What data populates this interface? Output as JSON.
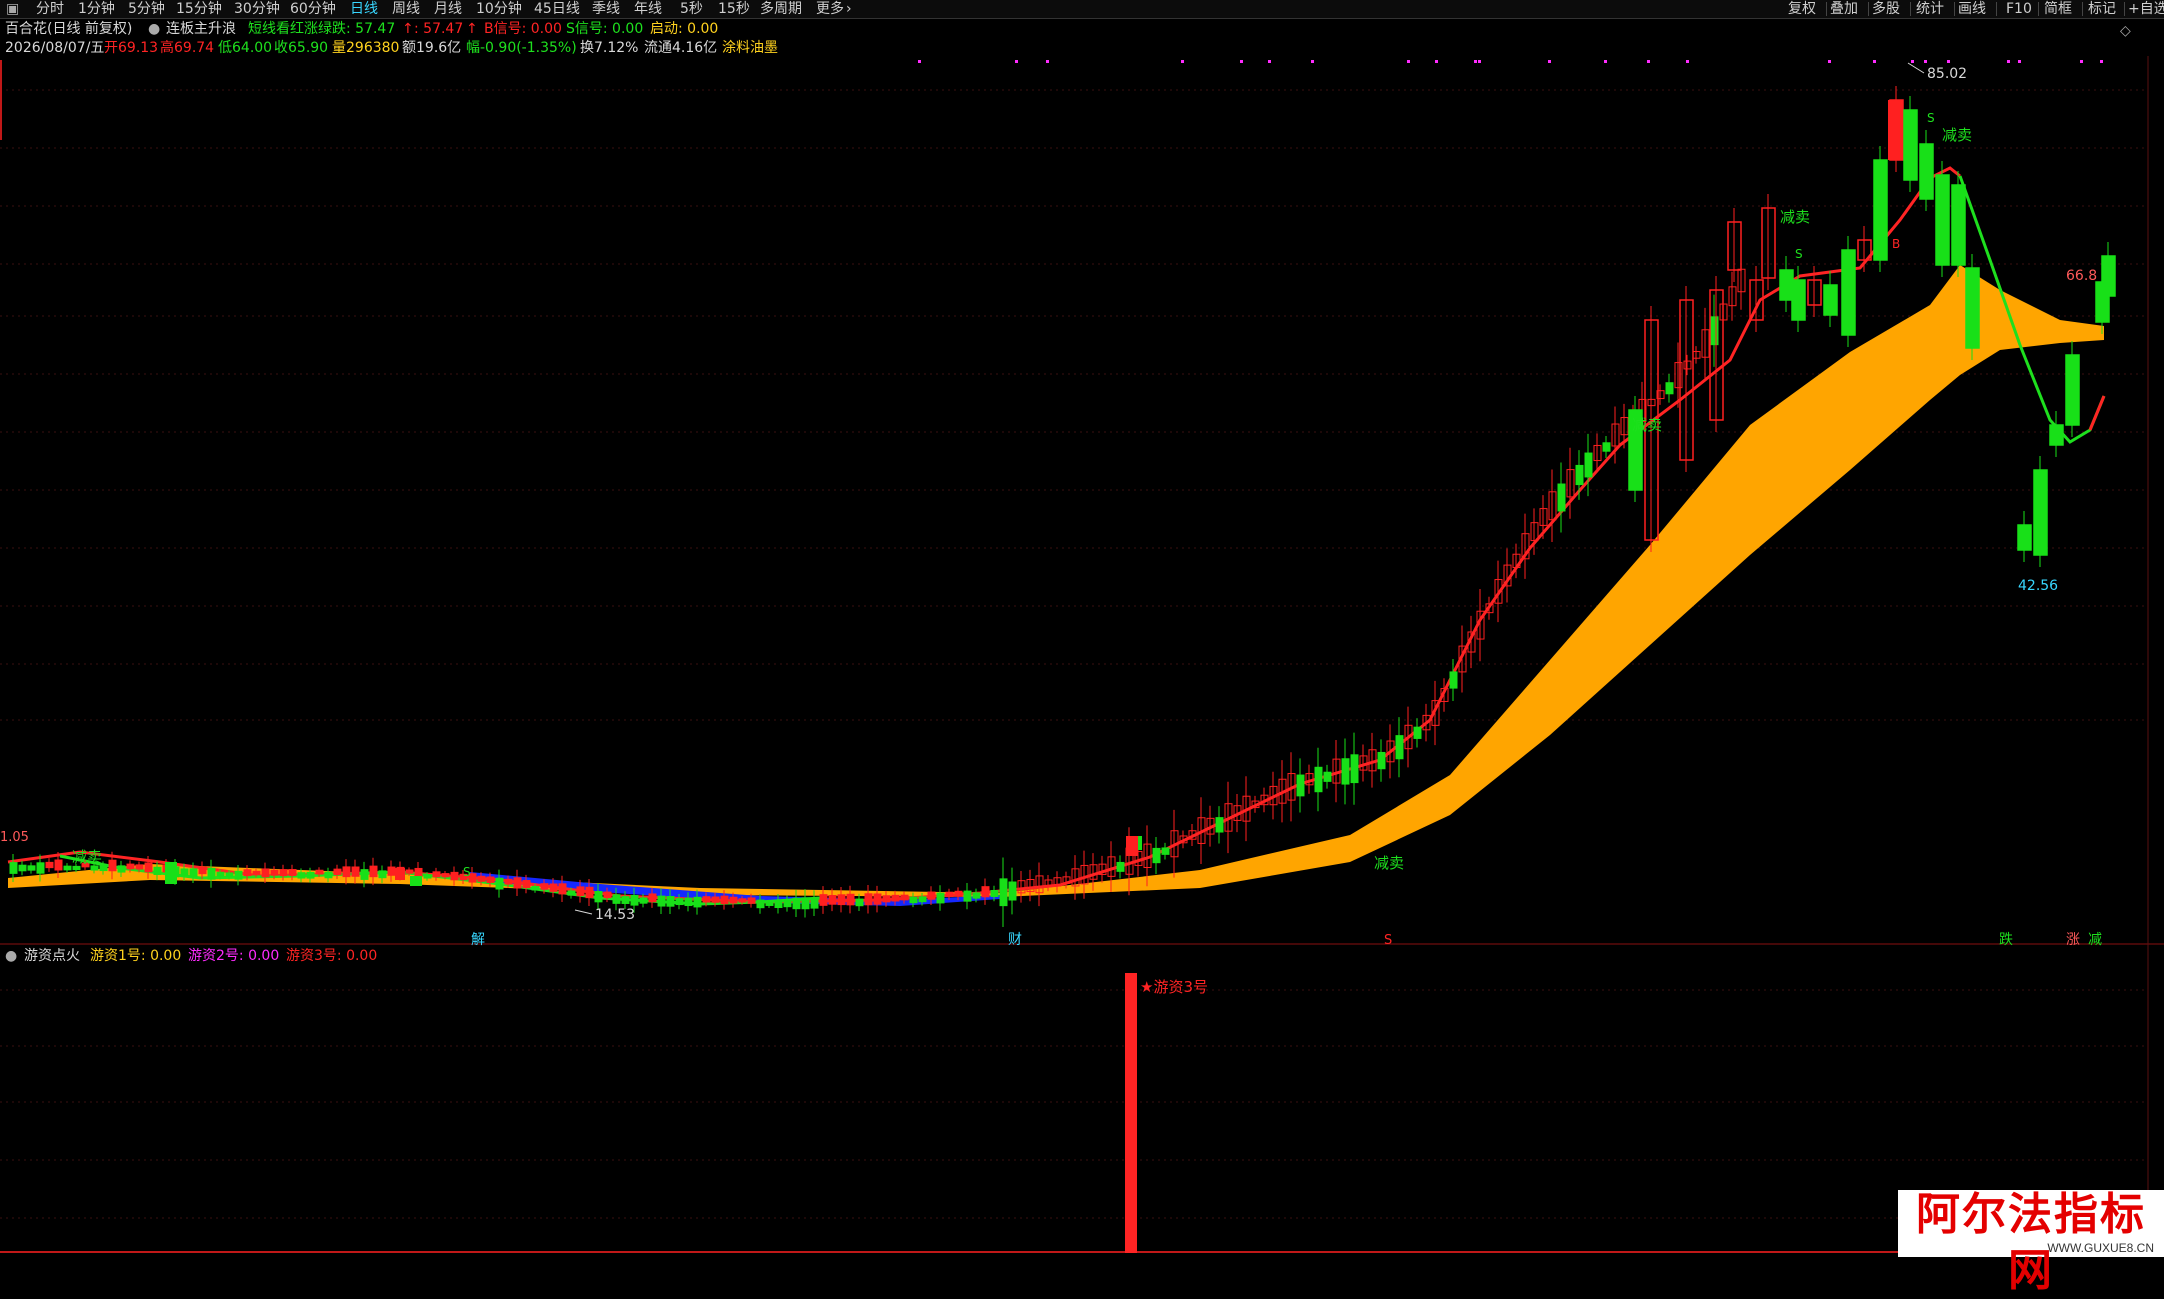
{
  "toolbar": {
    "tabs": [
      "分时",
      "1分钟",
      "5分钟",
      "15分钟",
      "30分钟",
      "60分钟",
      "日线",
      "周线",
      "月线",
      "10分钟",
      "45日线",
      "季线",
      "年线",
      "5秒",
      "15秒",
      "多周期",
      "更多"
    ],
    "active_tab": "日线",
    "right_buttons": [
      "复权",
      "叠加",
      "多股",
      "统计",
      "画线",
      "F10",
      "简框",
      "标记",
      "+自选"
    ]
  },
  "info_line1": {
    "stock_name": "百合花(日线 前复权)",
    "indicator_name": "连板主升浪",
    "short_line": "短线看红涨绿跌: 57.47",
    "value2": ": 57.47",
    "b_signal": "B信号: 0.00",
    "s_signal": "S信号: 0.00",
    "start": "启动: 0.00"
  },
  "info_line2": {
    "date": "2026/08/07/五",
    "open": "开69.13",
    "high": "高69.74",
    "low": "低64.00",
    "close": "收65.90",
    "volume": "量296380",
    "amount": "额19.6亿",
    "change": "幅-0.90(-1.35%)",
    "turnover": "换7.12%",
    "float": "流通4.16亿",
    "concept": "涂料油墨"
  },
  "price_labels": {
    "max": "85.02",
    "min": "42.56",
    "low_left": "14.53",
    "last": "66.8",
    "left_edge": "1.05"
  },
  "signal_labels": {
    "jian_mai": "减卖",
    "s_mark": "S",
    "b_mark": "B",
    "bottom_jie": "解",
    "bottom_cai": "财",
    "bottom_s": "S",
    "bottom_die": "跌",
    "bottom_zhang": "涨",
    "bottom_jian": "减",
    "hot_money3": "游资3号"
  },
  "indicator_header": {
    "name": "游资点火",
    "line1": "游资1号: 0.00",
    "line2": "游资2号: 0.00",
    "line3": "游资3号: 0.00"
  },
  "colors": {
    "up": "#ff2020",
    "down": "#18e018",
    "band": "#ffa500",
    "band_blue": "#1428ff",
    "ma_red": "#ff2424",
    "ma_green": "#1ee01e",
    "accent": "#38d7ff",
    "magenta": "#ff2cff"
  },
  "watermark": {
    "title": "阿尔法指标网",
    "url": "WWW.GUXUE8.CN"
  }
}
